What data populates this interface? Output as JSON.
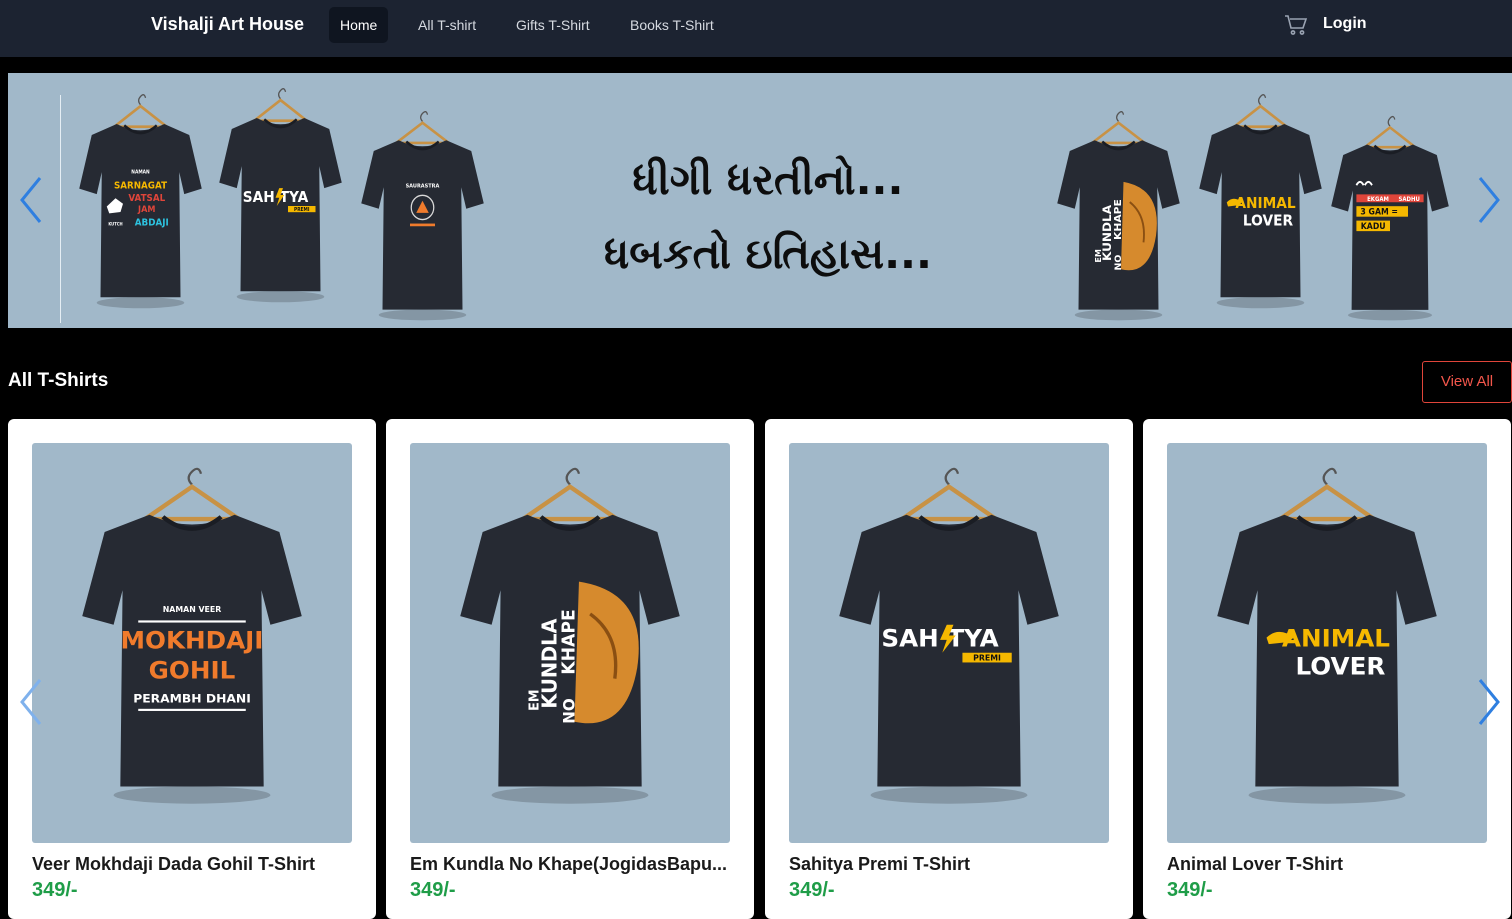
{
  "navbar": {
    "brand": "Vishalji Art House",
    "links": [
      {
        "label": "Home",
        "active": true
      },
      {
        "label": "All T-shirt",
        "active": false
      },
      {
        "label": "Gifts T-Shirt",
        "active": false
      },
      {
        "label": "Books T-Shirt",
        "active": false
      }
    ],
    "cart_icon": "cart-icon",
    "login_label": "Login"
  },
  "hero": {
    "line1": "ધીગી ધરતીનો...",
    "line2": "ધબકતો ઇતિહાસ...",
    "background": "#a1b8c9",
    "prev_icon": "chevron-left-icon",
    "next_icon": "chevron-right-icon",
    "shirts": [
      {
        "print": [
          "NAMAN",
          "SARNAGAT",
          "VATSAL",
          "JAM",
          "ABDAJI",
          "KUTCH"
        ]
      },
      {
        "print": [
          "SAH",
          "TYA",
          "PREMI"
        ]
      },
      {
        "print": [
          "SAURASTRA"
        ]
      },
      {
        "print": [
          "EM",
          "KUNDLA",
          "NO",
          "KHAPE"
        ]
      },
      {
        "print": [
          "ANIMAL",
          "LOVER"
        ]
      },
      {
        "print": [
          "EKGAM",
          "SADHU",
          "3 GAM",
          "KADU"
        ]
      }
    ]
  },
  "section": {
    "title": "All T-Shirts",
    "view_all_label": "View All"
  },
  "products": [
    {
      "name": "Veer Mokhdaji Dada Gohil T-Shirt",
      "price": "349/-",
      "print": [
        "NAMAN VEER",
        "MOKHDAJI",
        "GOHIL",
        "PERAMBH DHANI"
      ]
    },
    {
      "name": "Em Kundla No Khape(JogidasBapu...",
      "price": "349/-",
      "print": [
        "EM",
        "KUNDLA",
        "NO",
        "KHAPE"
      ]
    },
    {
      "name": "Sahitya Premi T-Shirt",
      "price": "349/-",
      "print": [
        "SAH",
        "TYA",
        "PREMI"
      ]
    },
    {
      "name": "Animal Lover T-Shirt",
      "price": "349/-",
      "print": [
        "ANIMAL",
        "LOVER"
      ]
    }
  ],
  "colors": {
    "navbar": "#1c2331",
    "accent_red": "#e0453a",
    "price_green": "#1f9d48",
    "arrow_blue": "#2f7fe0"
  }
}
